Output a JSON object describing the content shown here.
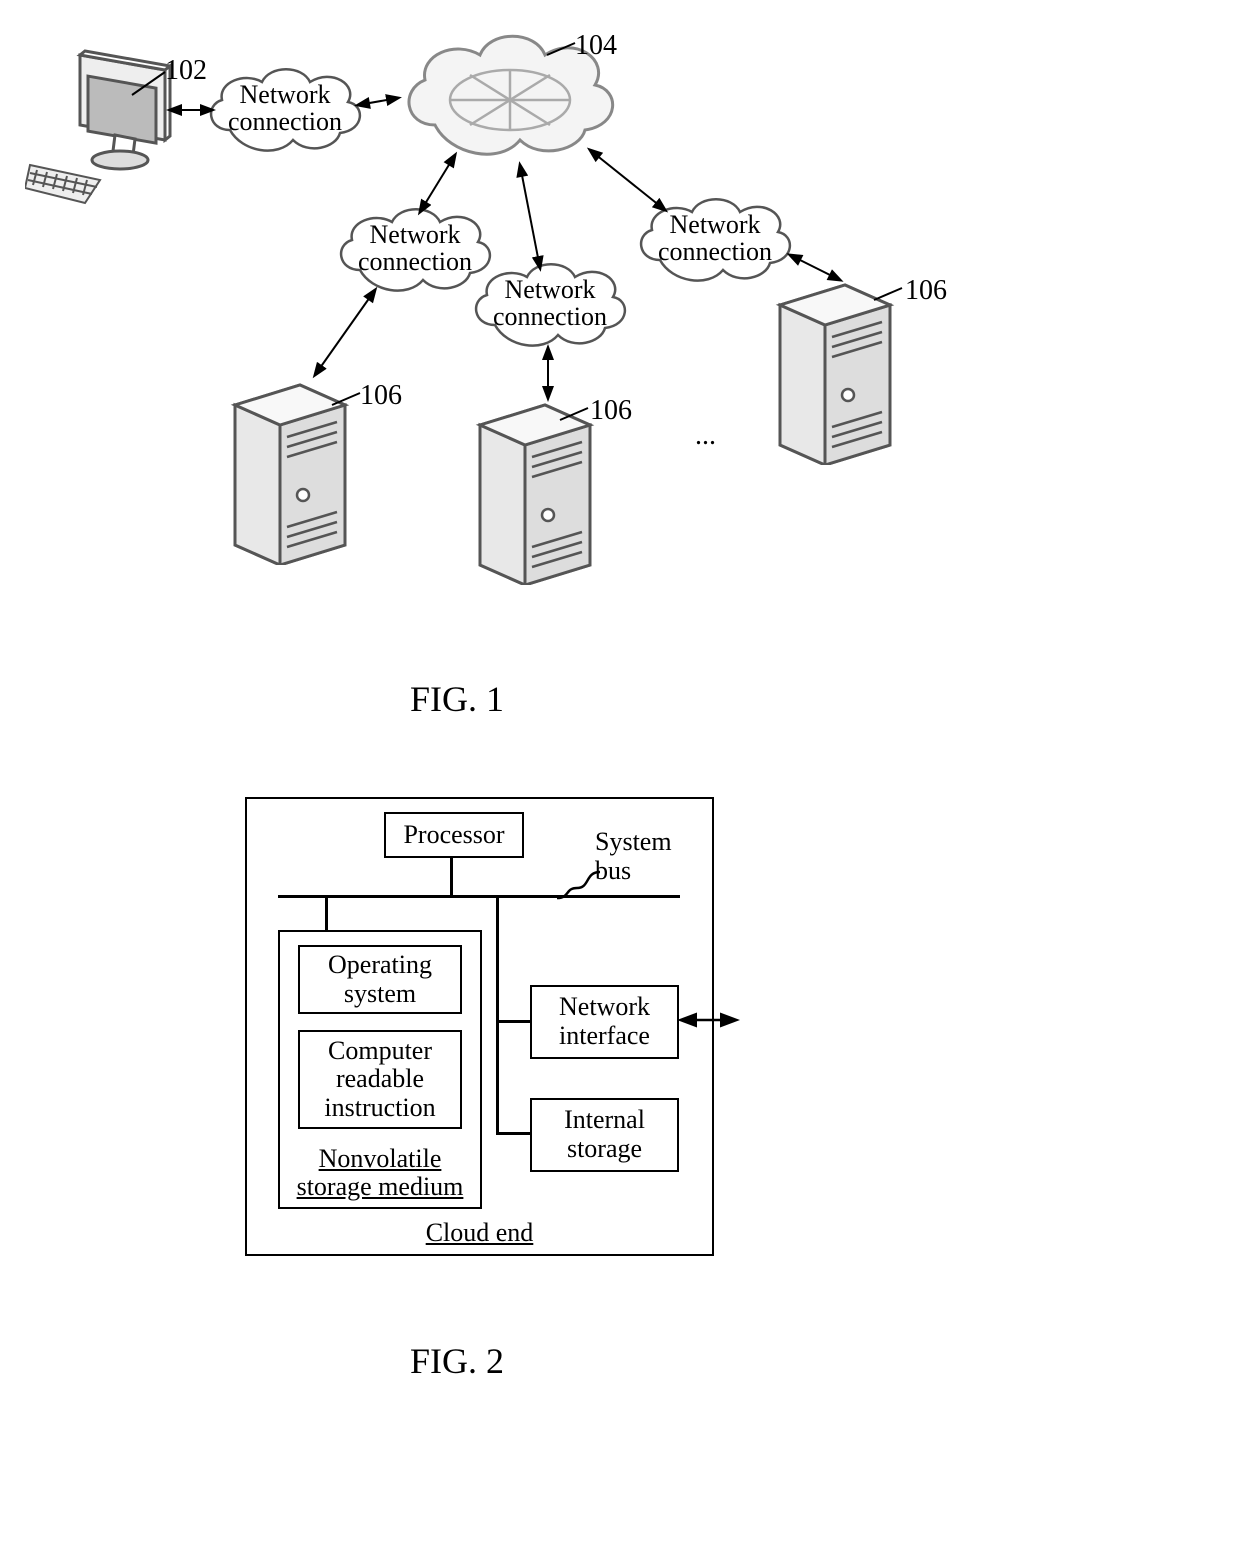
{
  "fig1": {
    "caption": "FIG. 1",
    "labels": {
      "l102": "102",
      "l104": "104",
      "l106a": "106",
      "l106b": "106",
      "l106c": "106"
    },
    "net_connection_text": "Network\nconnection",
    "ellipsis": "..."
  },
  "fig2": {
    "caption": "FIG. 2",
    "processor": "Processor",
    "system_bus": "System\nbus",
    "operating_system": "Operating\nsystem",
    "cri": "Computer\nreadable\ninstruction",
    "nvsm": "Nonvolatile\nstorage medium",
    "network_interface": "Network\ninterface",
    "internal_storage": "Internal\nstorage",
    "cloud_end": "Cloud end"
  }
}
